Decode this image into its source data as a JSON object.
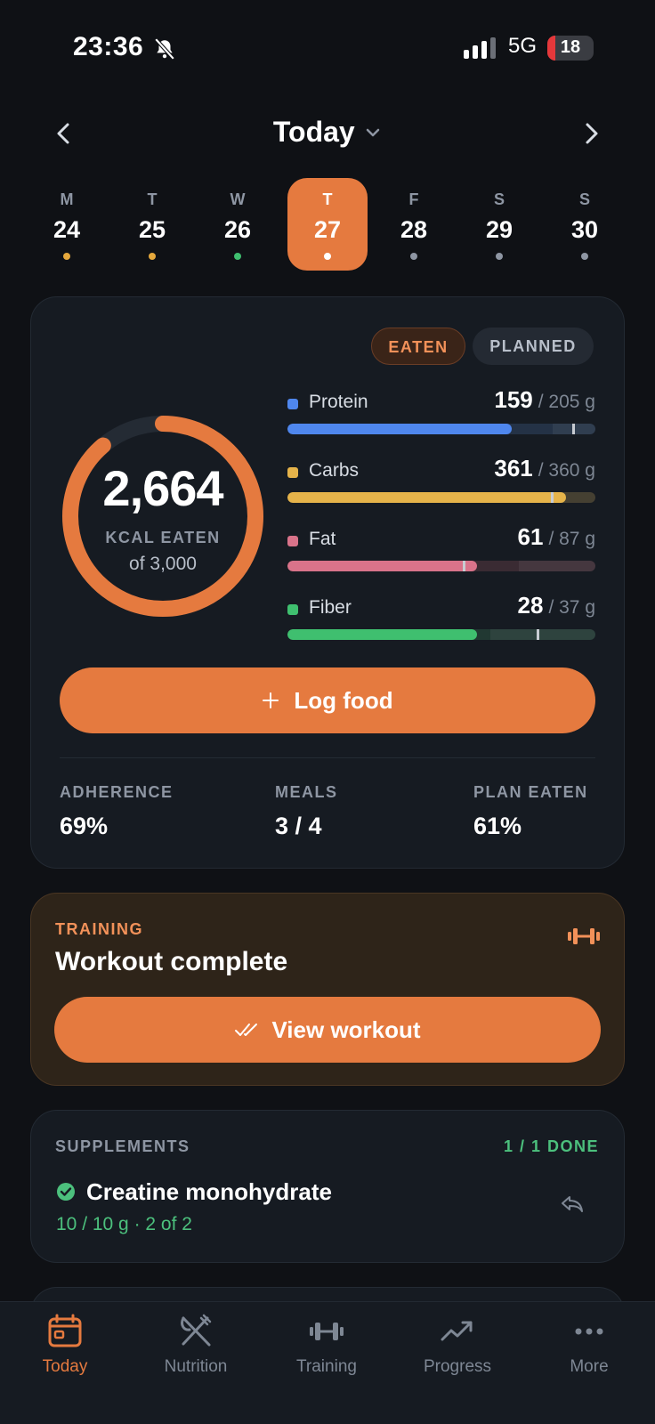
{
  "status_bar": {
    "time": "23:36",
    "network": "5G",
    "battery": "18",
    "battery_level": 0.18
  },
  "header": {
    "title": "Today"
  },
  "week": [
    {
      "letter": "M",
      "number": "24",
      "dot_color": "#e5a83c"
    },
    {
      "letter": "T",
      "number": "25",
      "dot_color": "#e5a83c"
    },
    {
      "letter": "W",
      "number": "26",
      "dot_color": "#3fbf6f"
    },
    {
      "letter": "T",
      "number": "27",
      "dot_color": "#ffffff",
      "selected": true
    },
    {
      "letter": "F",
      "number": "28",
      "dot_color": "#8e96a3"
    },
    {
      "letter": "S",
      "number": "29",
      "dot_color": "#8e96a3"
    },
    {
      "letter": "S",
      "number": "30",
      "dot_color": "#8e96a3"
    }
  ],
  "summary": {
    "toggle_eaten": "EATEN",
    "toggle_planned": "PLANNED",
    "kcal_value": "2,664",
    "kcal_label": "KCAL EATEN",
    "kcal_target": "of 3,000",
    "kcal_fraction": 0.888,
    "macros": [
      {
        "name": "Protein",
        "value": "159",
        "target": "/ 205 g",
        "color": "#4f87ee",
        "plan_color": "#243246",
        "eaten_fraction": 0.728,
        "plan_start": 0.86,
        "tick": 0.925
      },
      {
        "name": "Carbs",
        "value": "361",
        "target": "/ 360 g",
        "color": "#e5b34a",
        "plan_color": "#3a3526",
        "eaten_fraction": 0.905,
        "plan_start": 0.0,
        "tick": 0.855
      },
      {
        "name": "Fat",
        "value": "61",
        "target": "/ 87 g",
        "color": "#d9738a",
        "plan_color": "#3a2b33",
        "eaten_fraction": 0.615,
        "plan_start": 0.75,
        "tick": 0.57
      },
      {
        "name": "Fiber",
        "value": "28",
        "target": "/ 37 g",
        "color": "#3fbf6f",
        "plan_color": "#213832",
        "eaten_fraction": 0.615,
        "plan_start": 0.66,
        "tick": 0.81
      }
    ],
    "log_food_label": "Log food",
    "stats": [
      {
        "label": "ADHERENCE",
        "value": "69%"
      },
      {
        "label": "MEALS",
        "value": "3 / 4"
      },
      {
        "label": "PLAN EATEN",
        "value": "61%"
      }
    ]
  },
  "training": {
    "eyebrow": "TRAINING",
    "title": "Workout complete",
    "button_label": "View workout"
  },
  "supplements": {
    "eyebrow": "SUPPLEMENTS",
    "done_label": "1 / 1 DONE",
    "item_name": "Creatine monohydrate",
    "item_detail": "10 / 10 g · 2 of 2"
  },
  "bottom_nav": [
    {
      "label": "Today",
      "icon": "calendar-icon",
      "active": true
    },
    {
      "label": "Nutrition",
      "icon": "fork-knife-icon"
    },
    {
      "label": "Training",
      "icon": "dumbbell-icon"
    },
    {
      "label": "Progress",
      "icon": "trend-up-icon"
    },
    {
      "label": "More",
      "icon": "more-icon"
    }
  ],
  "colors": {
    "accent": "#e57a3f",
    "background": "#0f1115",
    "card": "#161b22",
    "success": "#4cc07d"
  }
}
